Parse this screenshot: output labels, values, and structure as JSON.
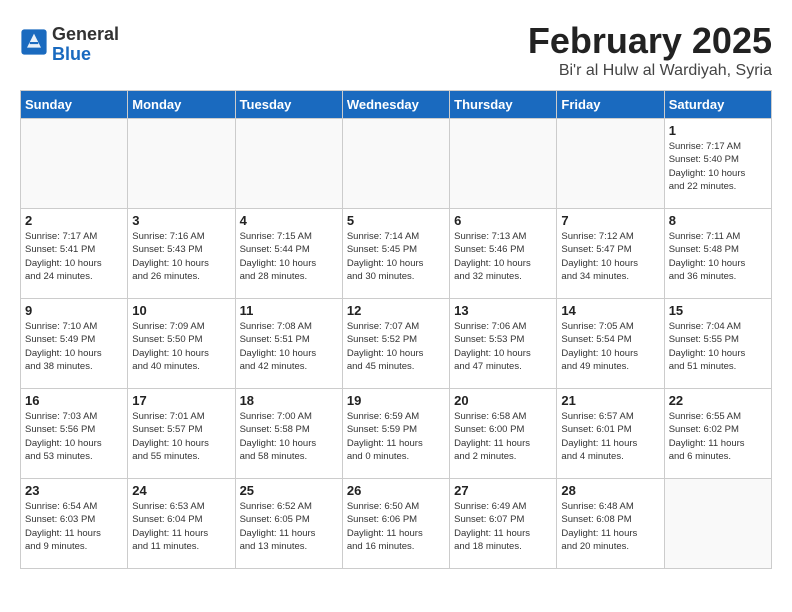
{
  "header": {
    "logo_general": "General",
    "logo_blue": "Blue",
    "title": "February 2025",
    "location": "Bi'r al Hulw al Wardiyah, Syria"
  },
  "days_of_week": [
    "Sunday",
    "Monday",
    "Tuesday",
    "Wednesday",
    "Thursday",
    "Friday",
    "Saturday"
  ],
  "weeks": [
    [
      {
        "day": "",
        "info": ""
      },
      {
        "day": "",
        "info": ""
      },
      {
        "day": "",
        "info": ""
      },
      {
        "day": "",
        "info": ""
      },
      {
        "day": "",
        "info": ""
      },
      {
        "day": "",
        "info": ""
      },
      {
        "day": "1",
        "info": "Sunrise: 7:17 AM\nSunset: 5:40 PM\nDaylight: 10 hours\nand 22 minutes."
      }
    ],
    [
      {
        "day": "2",
        "info": "Sunrise: 7:17 AM\nSunset: 5:41 PM\nDaylight: 10 hours\nand 24 minutes."
      },
      {
        "day": "3",
        "info": "Sunrise: 7:16 AM\nSunset: 5:43 PM\nDaylight: 10 hours\nand 26 minutes."
      },
      {
        "day": "4",
        "info": "Sunrise: 7:15 AM\nSunset: 5:44 PM\nDaylight: 10 hours\nand 28 minutes."
      },
      {
        "day": "5",
        "info": "Sunrise: 7:14 AM\nSunset: 5:45 PM\nDaylight: 10 hours\nand 30 minutes."
      },
      {
        "day": "6",
        "info": "Sunrise: 7:13 AM\nSunset: 5:46 PM\nDaylight: 10 hours\nand 32 minutes."
      },
      {
        "day": "7",
        "info": "Sunrise: 7:12 AM\nSunset: 5:47 PM\nDaylight: 10 hours\nand 34 minutes."
      },
      {
        "day": "8",
        "info": "Sunrise: 7:11 AM\nSunset: 5:48 PM\nDaylight: 10 hours\nand 36 minutes."
      }
    ],
    [
      {
        "day": "9",
        "info": "Sunrise: 7:10 AM\nSunset: 5:49 PM\nDaylight: 10 hours\nand 38 minutes."
      },
      {
        "day": "10",
        "info": "Sunrise: 7:09 AM\nSunset: 5:50 PM\nDaylight: 10 hours\nand 40 minutes."
      },
      {
        "day": "11",
        "info": "Sunrise: 7:08 AM\nSunset: 5:51 PM\nDaylight: 10 hours\nand 42 minutes."
      },
      {
        "day": "12",
        "info": "Sunrise: 7:07 AM\nSunset: 5:52 PM\nDaylight: 10 hours\nand 45 minutes."
      },
      {
        "day": "13",
        "info": "Sunrise: 7:06 AM\nSunset: 5:53 PM\nDaylight: 10 hours\nand 47 minutes."
      },
      {
        "day": "14",
        "info": "Sunrise: 7:05 AM\nSunset: 5:54 PM\nDaylight: 10 hours\nand 49 minutes."
      },
      {
        "day": "15",
        "info": "Sunrise: 7:04 AM\nSunset: 5:55 PM\nDaylight: 10 hours\nand 51 minutes."
      }
    ],
    [
      {
        "day": "16",
        "info": "Sunrise: 7:03 AM\nSunset: 5:56 PM\nDaylight: 10 hours\nand 53 minutes."
      },
      {
        "day": "17",
        "info": "Sunrise: 7:01 AM\nSunset: 5:57 PM\nDaylight: 10 hours\nand 55 minutes."
      },
      {
        "day": "18",
        "info": "Sunrise: 7:00 AM\nSunset: 5:58 PM\nDaylight: 10 hours\nand 58 minutes."
      },
      {
        "day": "19",
        "info": "Sunrise: 6:59 AM\nSunset: 5:59 PM\nDaylight: 11 hours\nand 0 minutes."
      },
      {
        "day": "20",
        "info": "Sunrise: 6:58 AM\nSunset: 6:00 PM\nDaylight: 11 hours\nand 2 minutes."
      },
      {
        "day": "21",
        "info": "Sunrise: 6:57 AM\nSunset: 6:01 PM\nDaylight: 11 hours\nand 4 minutes."
      },
      {
        "day": "22",
        "info": "Sunrise: 6:55 AM\nSunset: 6:02 PM\nDaylight: 11 hours\nand 6 minutes."
      }
    ],
    [
      {
        "day": "23",
        "info": "Sunrise: 6:54 AM\nSunset: 6:03 PM\nDaylight: 11 hours\nand 9 minutes."
      },
      {
        "day": "24",
        "info": "Sunrise: 6:53 AM\nSunset: 6:04 PM\nDaylight: 11 hours\nand 11 minutes."
      },
      {
        "day": "25",
        "info": "Sunrise: 6:52 AM\nSunset: 6:05 PM\nDaylight: 11 hours\nand 13 minutes."
      },
      {
        "day": "26",
        "info": "Sunrise: 6:50 AM\nSunset: 6:06 PM\nDaylight: 11 hours\nand 16 minutes."
      },
      {
        "day": "27",
        "info": "Sunrise: 6:49 AM\nSunset: 6:07 PM\nDaylight: 11 hours\nand 18 minutes."
      },
      {
        "day": "28",
        "info": "Sunrise: 6:48 AM\nSunset: 6:08 PM\nDaylight: 11 hours\nand 20 minutes."
      },
      {
        "day": "",
        "info": ""
      }
    ]
  ]
}
